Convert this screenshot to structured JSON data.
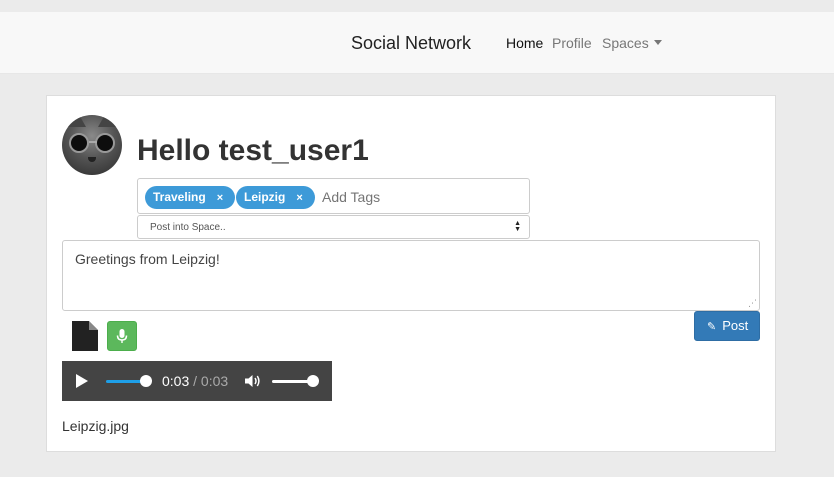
{
  "navbar": {
    "brand": "Social Network",
    "items": [
      {
        "label": "Home",
        "active": true
      },
      {
        "label": "Profile",
        "active": false
      },
      {
        "label": "Spaces",
        "active": false
      }
    ]
  },
  "composer": {
    "greeting": "Hello test_user1",
    "tags": [
      {
        "label": "Traveling"
      },
      {
        "label": "Leipzig"
      }
    ],
    "tag_remove_glyph": "×",
    "tags_placeholder": "Add Tags",
    "space_select": {
      "selected": "Post into Space.."
    },
    "text": "Greetings from Leipzig!",
    "post_label": "Post"
  },
  "audio_player": {
    "current_time": "0:03",
    "separator": "/",
    "duration": "0:03",
    "progress": 1.0,
    "volume": 1.0
  },
  "attachment": {
    "filename": "Leipzig.jpg"
  },
  "colors": {
    "accent": "#337ab7",
    "tag": "#3d9ad8",
    "mic": "#5cb85c",
    "player": "#444444"
  },
  "icons": [
    "document-icon",
    "microphone-icon",
    "pencil-icon",
    "play-icon",
    "volume-icon",
    "select-arrows-icon",
    "resize-handle-icon"
  ]
}
